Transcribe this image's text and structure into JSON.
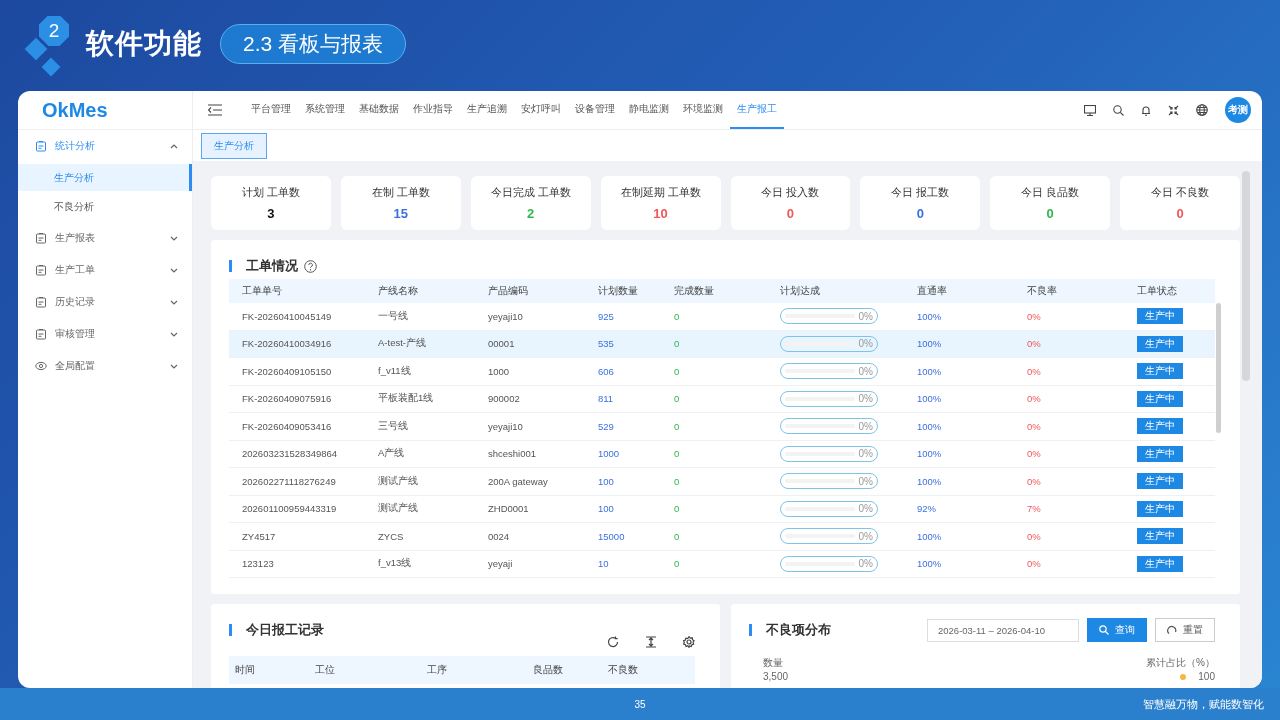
{
  "slide": {
    "badge": "2",
    "title": "软件功能",
    "section": "2.3 看板与报表",
    "page": "35",
    "slogan": "智慧融万物，赋能数智化"
  },
  "app": {
    "logo": "OkMes",
    "sidebar": [
      {
        "label": "统计分析",
        "expanded": true,
        "children": [
          {
            "label": "生产分析",
            "selected": true
          },
          {
            "label": "不良分析",
            "selected": false
          }
        ]
      },
      {
        "label": "生产报表",
        "expanded": false
      },
      {
        "label": "生产工单",
        "expanded": false
      },
      {
        "label": "历史记录",
        "expanded": false
      },
      {
        "label": "审核管理",
        "expanded": false
      },
      {
        "label": "全局配置",
        "expanded": false
      }
    ],
    "nav": [
      {
        "label": "平台管理",
        "selected": false
      },
      {
        "label": "系统管理",
        "selected": false
      },
      {
        "label": "基础数据",
        "selected": false
      },
      {
        "label": "作业指导",
        "selected": false
      },
      {
        "label": "生产追溯",
        "selected": false
      },
      {
        "label": "安灯呼叫",
        "selected": false
      },
      {
        "label": "设备管理",
        "selected": false
      },
      {
        "label": "静电监测",
        "selected": false
      },
      {
        "label": "环境监测",
        "selected": false
      },
      {
        "label": "生产报工",
        "selected": true
      }
    ],
    "avatar": "考测",
    "tabs": [
      {
        "label": "生产分析",
        "selected": true
      }
    ],
    "stats": [
      {
        "label": "计划 工单数",
        "value": "3",
        "color": "#111111"
      },
      {
        "label": "在制 工单数",
        "value": "15",
        "color": "#3b6fe0"
      },
      {
        "label": "今日完成 工单数",
        "value": "2",
        "color": "#2fb84a"
      },
      {
        "label": "在制延期 工单数",
        "value": "10",
        "color": "#f0575a"
      },
      {
        "label": "今日 投入数",
        "value": "0",
        "color": "#f0575a"
      },
      {
        "label": "今日 报工数",
        "value": "0",
        "color": "#3b6fe0"
      },
      {
        "label": "今日 良品数",
        "value": "0",
        "color": "#2fb84a"
      },
      {
        "label": "今日 不良数",
        "value": "0",
        "color": "#f0575a"
      }
    ],
    "orders": {
      "title": "工单情况",
      "columns": [
        "工单单号",
        "产线名称",
        "产品编码",
        "计划数量",
        "完成数量",
        "计划达成",
        "直通率",
        "不良率",
        "工单状态"
      ],
      "rows": [
        {
          "cells": [
            "FK-20260410045149",
            "一号线",
            "yeyaji10",
            "925",
            "0"
          ],
          "progress": {
            "level": 0,
            "reading": "0%"
          },
          "pass_rate": "100%",
          "defect_rate": "0%",
          "status": "生产中",
          "selected": false
        },
        {
          "cells": [
            "FK-20260410034916",
            "A-test-产线",
            "00001",
            "535",
            "0"
          ],
          "progress": {
            "level": 0,
            "reading": "0%"
          },
          "pass_rate": "100%",
          "defect_rate": "0%",
          "status": "生产中",
          "selected": true
        },
        {
          "cells": [
            "FK-20260409105150",
            "f_v11线",
            "1000",
            "606",
            "0"
          ],
          "progress": {
            "level": 0,
            "reading": "0%"
          },
          "pass_rate": "100%",
          "defect_rate": "0%",
          "status": "生产中",
          "selected": false
        },
        {
          "cells": [
            "FK-20260409075916",
            "平板装配1线",
            "900002",
            "811",
            "0"
          ],
          "progress": {
            "level": 0,
            "reading": "0%"
          },
          "pass_rate": "100%",
          "defect_rate": "0%",
          "status": "生产中",
          "selected": false
        },
        {
          "cells": [
            "FK-20260409053416",
            "三号线",
            "yeyaji10",
            "529",
            "0"
          ],
          "progress": {
            "level": 0,
            "reading": "0%"
          },
          "pass_rate": "100%",
          "defect_rate": "0%",
          "status": "生产中",
          "selected": false
        },
        {
          "cells": [
            "202603231528349864",
            "A产线",
            "shceshi001",
            "1000",
            "0"
          ],
          "progress": {
            "level": 0,
            "reading": "0%"
          },
          "pass_rate": "100%",
          "defect_rate": "0%",
          "status": "生产中",
          "selected": false
        },
        {
          "cells": [
            "202602271118276249",
            "测试产线",
            "200A gateway",
            "100",
            "0"
          ],
          "progress": {
            "level": 0,
            "reading": "0%"
          },
          "pass_rate": "100%",
          "defect_rate": "0%",
          "status": "生产中",
          "selected": false
        },
        {
          "cells": [
            "202601100959443319",
            "测试产线",
            "ZHD0001",
            "100",
            "0"
          ],
          "progress": {
            "level": 0,
            "reading": "0%"
          },
          "pass_rate": "92%",
          "defect_rate": "7%",
          "status": "生产中",
          "selected": false
        },
        {
          "cells": [
            "ZY4517",
            "ZYCS",
            "0024",
            "15000",
            "0"
          ],
          "progress": {
            "level": 0,
            "reading": "0%"
          },
          "pass_rate": "100%",
          "defect_rate": "0%",
          "status": "生产中",
          "selected": false
        },
        {
          "cells": [
            "123123",
            "f_v13线",
            "yeyaji",
            "10",
            "0"
          ],
          "progress": {
            "level": 0,
            "reading": "0%"
          },
          "pass_rate": "100%",
          "defect_rate": "0%",
          "status": "生产中",
          "selected": false
        }
      ]
    },
    "report": {
      "title": "今日报工记录",
      "columns": [
        "时间",
        "工位",
        "工序",
        "良品数",
        "不良数"
      ]
    },
    "defects": {
      "title": "不良项分布",
      "date_range": "2026-03-11 – 2026-04-10",
      "buttons": [
        {
          "label": "查询",
          "kind": "primary"
        },
        {
          "label": "重置",
          "kind": "default"
        }
      ],
      "axis": {
        "left_title": "数量",
        "left_tick": "3,500",
        "right_title": "累计占比（%）",
        "right_tick": "100"
      }
    }
  }
}
